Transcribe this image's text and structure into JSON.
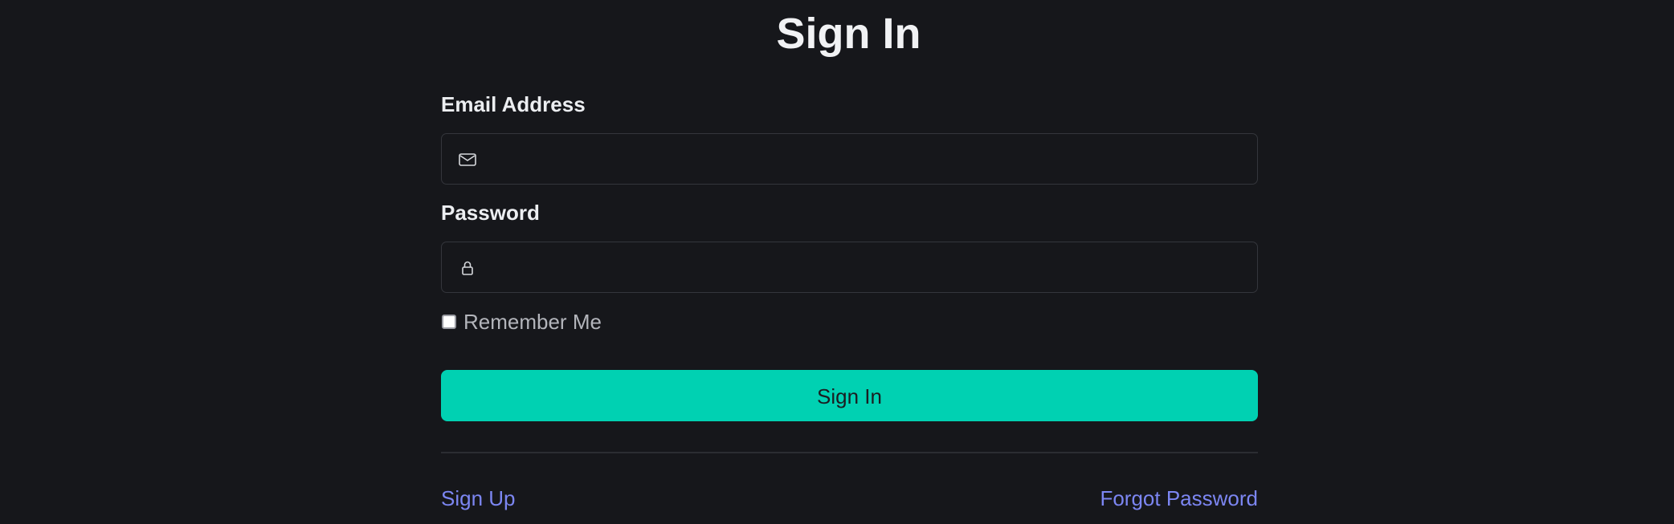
{
  "page": {
    "title": "Sign In"
  },
  "form": {
    "email": {
      "label": "Email Address",
      "value": "",
      "placeholder": "",
      "icon": "envelope-icon"
    },
    "password": {
      "label": "Password",
      "value": "",
      "placeholder": "",
      "icon": "lock-icon"
    },
    "remember": {
      "label": "Remember Me",
      "checked": false
    },
    "submit_label": "Sign In"
  },
  "links": {
    "signup": "Sign Up",
    "forgot": "Forgot Password"
  },
  "colors": {
    "background": "#16171b",
    "primary_button": "#00d1b2",
    "link": "#7c86f2",
    "field_border": "#34363c"
  }
}
